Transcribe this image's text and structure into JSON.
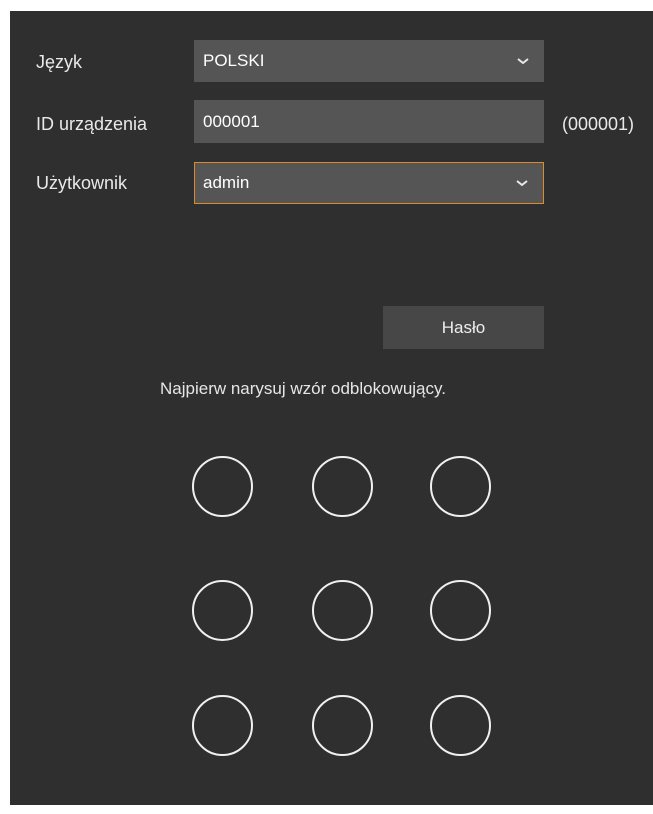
{
  "form": {
    "language": {
      "label": "Język",
      "value": "POLSKI"
    },
    "device_id": {
      "label": "ID urządzenia",
      "value": "000001",
      "hint": "(000001)"
    },
    "user": {
      "label": "Użytkownik",
      "value": "admin"
    }
  },
  "password_button": {
    "label": "Hasło"
  },
  "pattern": {
    "instruction": "Najpierw narysuj wzór odblokowujący.",
    "rows": 3,
    "cols": 3
  },
  "colors": {
    "panel_background": "#2f2f2f",
    "field_background": "#555555",
    "button_background": "#474747",
    "focus_border": "#d98c2b",
    "text": "#e9e9e9"
  }
}
